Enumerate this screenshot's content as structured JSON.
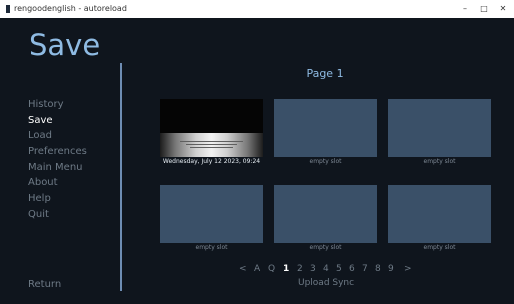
{
  "window": {
    "title": "rengoodenglish - autoreload",
    "controls": {
      "minimize": "–",
      "maximize": "□",
      "close": "✕"
    }
  },
  "screen": {
    "title": "Save"
  },
  "menu": {
    "items": [
      {
        "label": "History",
        "active": false
      },
      {
        "label": "Save",
        "active": true
      },
      {
        "label": "Load",
        "active": false
      },
      {
        "label": "Preferences",
        "active": false
      },
      {
        "label": "Main Menu",
        "active": false
      },
      {
        "label": "About",
        "active": false
      },
      {
        "label": "Help",
        "active": false
      },
      {
        "label": "Quit",
        "active": false
      }
    ],
    "return_label": "Return"
  },
  "page_label": "Page 1",
  "slots": [
    {
      "caption": "Wednesday, July 12 2023, 09:24",
      "filled": true
    },
    {
      "caption": "empty slot",
      "filled": false
    },
    {
      "caption": "empty slot",
      "filled": false
    },
    {
      "caption": "empty slot",
      "filled": false
    },
    {
      "caption": "empty slot",
      "filled": false
    },
    {
      "caption": "empty slot",
      "filled": false
    }
  ],
  "pager": {
    "items": [
      "<",
      "A",
      "Q",
      "1",
      "2",
      "3",
      "4",
      "5",
      "6",
      "7",
      "8",
      "9",
      ">"
    ],
    "current": "1"
  },
  "upload_sync": "Upload Sync",
  "colors": {
    "background": "#0f151d",
    "accent": "#8fbbe3",
    "slot": "#3a5068",
    "menu_text": "#6e7a86",
    "divider": "#6e8db3"
  }
}
